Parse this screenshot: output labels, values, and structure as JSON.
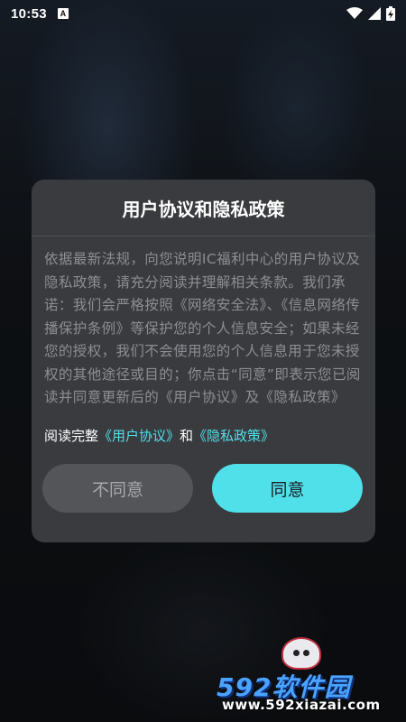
{
  "status_bar": {
    "time": "10:53",
    "notification_icon": "a-icon",
    "icons": [
      "wifi-icon",
      "signal-icon",
      "battery-charging-icon"
    ]
  },
  "dialog": {
    "title": "用户协议和隐私政策",
    "body": "依据最新法规，向您说明IC福利中心的用户协议及隐私政策，请充分阅读并理解相关条款。我们承诺：我们会严格按照《网络安全法》、《信息网络传播保护条例》等保护您的个人信息安全；如果未经您的授权，我们不会使用您的个人信息用于您未授权的其他途径或目的；你点击“同意”即表示您已阅读并同意更新后的《用户协议》及《隐私政策》",
    "read_prefix": "阅读完整",
    "user_agreement_link": "《用户协议》",
    "and_text": "和",
    "privacy_policy_link": "《隐私政策》",
    "disagree_label": "不同意",
    "agree_label": "同意",
    "accent_color": "#4fe0ea"
  },
  "watermark": {
    "brand": "592软件园",
    "url": "www.592xiazai.com"
  }
}
